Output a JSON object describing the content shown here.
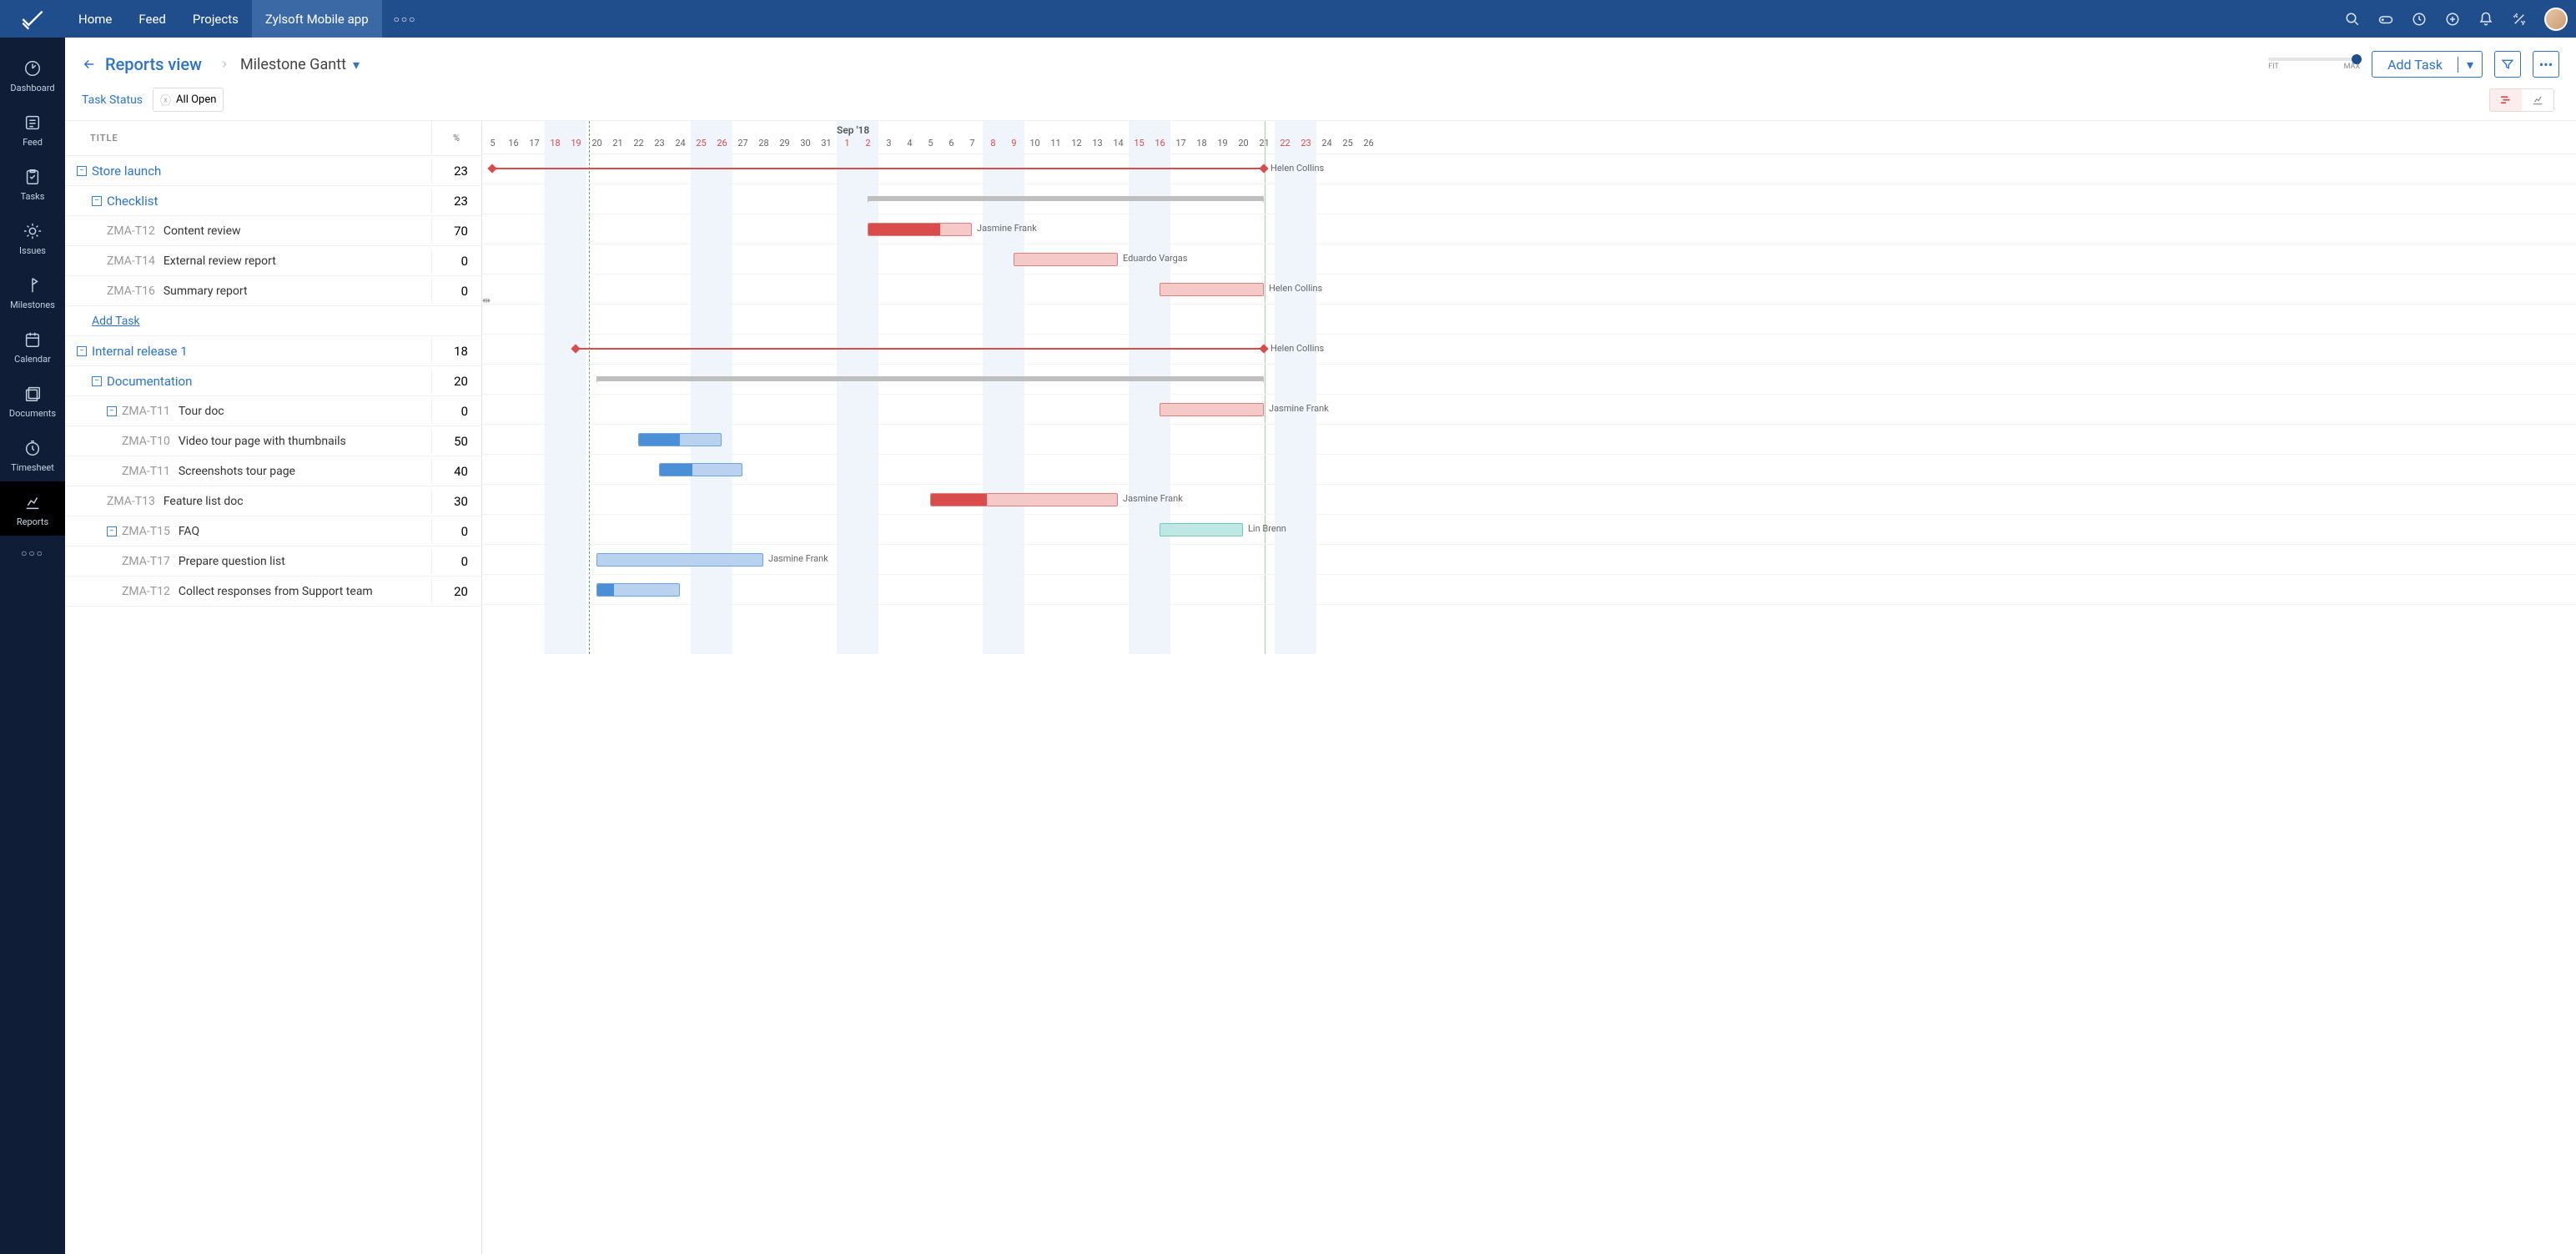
{
  "topnav": {
    "tabs": [
      "Home",
      "Feed",
      "Projects",
      "Zylsoft Mobile app"
    ],
    "active_tab": "Zylsoft Mobile app"
  },
  "rail": {
    "items": [
      "Dashboard",
      "Feed",
      "Tasks",
      "Issues",
      "Milestones",
      "Calendar",
      "Documents",
      "Timesheet",
      "Reports"
    ],
    "active": "Reports"
  },
  "header": {
    "title": "Reports view",
    "subtitle": "Milestone Gantt",
    "zoom": {
      "min_label": "FIT",
      "max_label": "MAX"
    },
    "add_task_label": "Add Task"
  },
  "filter": {
    "label": "Task Status",
    "chip": "All Open"
  },
  "columns": {
    "title": "TITLE",
    "pct": "%"
  },
  "timeline": {
    "month_label": "Sep '18",
    "days": [
      {
        "n": "5"
      },
      {
        "n": "16"
      },
      {
        "n": "17"
      },
      {
        "n": "18",
        "we": true
      },
      {
        "n": "19",
        "we": true
      },
      {
        "n": "20"
      },
      {
        "n": "21"
      },
      {
        "n": "22"
      },
      {
        "n": "23"
      },
      {
        "n": "24"
      },
      {
        "n": "25",
        "we": true
      },
      {
        "n": "26",
        "we": true
      },
      {
        "n": "27"
      },
      {
        "n": "28"
      },
      {
        "n": "29"
      },
      {
        "n": "30"
      },
      {
        "n": "31"
      },
      {
        "n": "1",
        "we": true
      },
      {
        "n": "2",
        "we": true
      },
      {
        "n": "3"
      },
      {
        "n": "4"
      },
      {
        "n": "5"
      },
      {
        "n": "6"
      },
      {
        "n": "7"
      },
      {
        "n": "8",
        "we": true
      },
      {
        "n": "9",
        "we": true
      },
      {
        "n": "10"
      },
      {
        "n": "11"
      },
      {
        "n": "12"
      },
      {
        "n": "13"
      },
      {
        "n": "14"
      },
      {
        "n": "15",
        "we": true
      },
      {
        "n": "16",
        "we": true
      },
      {
        "n": "17"
      },
      {
        "n": "18"
      },
      {
        "n": "19"
      },
      {
        "n": "20"
      },
      {
        "n": "21"
      },
      {
        "n": "22",
        "we": true
      },
      {
        "n": "23",
        "we": true
      },
      {
        "n": "24"
      },
      {
        "n": "25"
      },
      {
        "n": "26"
      }
    ]
  },
  "rows": [
    {
      "type": "milestone",
      "lvl": 0,
      "name": "Store launch",
      "pct": 23,
      "barStart": 0,
      "barEnd": 37,
      "lineStart": 5,
      "assignee": "Helen Collins"
    },
    {
      "type": "group",
      "lvl": 1,
      "name": "Checklist",
      "pct": 23,
      "sumStart": 18,
      "sumEnd": 37
    },
    {
      "type": "task",
      "lvl": 2,
      "key": "ZMA-T12",
      "name": "Content review",
      "pct": 70,
      "color": "red",
      "barStart": 18,
      "barEnd": 23,
      "fill": 70,
      "assignee": "Jasmine Frank"
    },
    {
      "type": "task",
      "lvl": 2,
      "key": "ZMA-T14",
      "name": "External review report",
      "pct": 0,
      "color": "red",
      "barStart": 25,
      "barEnd": 30,
      "fill": 0,
      "assignee": "Eduardo Vargas",
      "depFrom": 0
    },
    {
      "type": "task",
      "lvl": 2,
      "key": "ZMA-T16",
      "name": "Summary report",
      "pct": 0,
      "color": "red",
      "barStart": 32,
      "barEnd": 37,
      "fill": 0,
      "assignee": "Helen Collins"
    },
    {
      "type": "add",
      "lvl": 1,
      "label": "Add Task"
    },
    {
      "type": "milestone",
      "lvl": 0,
      "name": "Internal release 1",
      "pct": 18,
      "barStart": 4,
      "barEnd": 37,
      "lineStart": 9,
      "assignee": "Helen Collins"
    },
    {
      "type": "group",
      "lvl": 1,
      "name": "Documentation",
      "pct": 20,
      "sumStart": 5,
      "sumEnd": 37
    },
    {
      "type": "taskgrp",
      "lvl": 2,
      "key": "ZMA-T11",
      "name": "Tour doc",
      "pct": 0,
      "color": "red",
      "barStart": 32,
      "barEnd": 37,
      "fill": 0,
      "assignee": "Jasmine Frank"
    },
    {
      "type": "task",
      "lvl": 3,
      "key": "ZMA-T10",
      "name": "Video tour page with thumbnails",
      "pct": 50,
      "color": "blue",
      "barStart": 7,
      "barEnd": 11,
      "fill": 50
    },
    {
      "type": "task",
      "lvl": 3,
      "key": "ZMA-T11",
      "name": "Screenshots tour page",
      "pct": 40,
      "color": "blue",
      "barStart": 8,
      "barEnd": 12,
      "fill": 40
    },
    {
      "type": "task",
      "lvl": 2,
      "key": "ZMA-T13",
      "name": "Feature list doc",
      "pct": 30,
      "color": "red",
      "barStart": 21,
      "barEnd": 30,
      "fill": 30,
      "assignee": "Jasmine Frank"
    },
    {
      "type": "taskgrp",
      "lvl": 2,
      "key": "ZMA-T15",
      "name": "FAQ",
      "pct": 0,
      "color": "teal",
      "barStart": 32,
      "barEnd": 36,
      "fill": 0,
      "assignee": "Lin Brenn",
      "depTeal": true
    },
    {
      "type": "task",
      "lvl": 3,
      "key": "ZMA-T17",
      "name": "Prepare question list",
      "pct": 0,
      "color": "blue",
      "barStart": 5,
      "barEnd": 13,
      "fill": 0,
      "assignee": "Jasmine Frank"
    },
    {
      "type": "task",
      "lvl": 3,
      "key": "ZMA-T12",
      "name": "Collect responses from Support team",
      "pct": 20,
      "color": "blue",
      "barStart": 5,
      "barEnd": 9,
      "fill": 20
    }
  ]
}
